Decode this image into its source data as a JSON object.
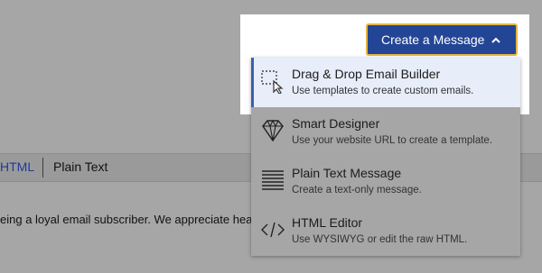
{
  "background": {
    "tabs": {
      "html_label": "HTML",
      "plain_text_label": "Plain Text"
    },
    "body_text": "eing a loyal email subscriber. We appreciate hearing"
  },
  "create_button": {
    "label": "Create a Message",
    "icon": "chevron-up-icon"
  },
  "menu": {
    "items": [
      {
        "title": "Drag & Drop Email Builder",
        "subtitle": "Use templates to create custom emails.",
        "icon": "drag-drop-icon",
        "active": true
      },
      {
        "title": "Smart Designer",
        "subtitle": "Use your website URL to create a template.",
        "icon": "diamond-icon",
        "active": false
      },
      {
        "title": "Plain Text Message",
        "subtitle": "Create a text-only message.",
        "icon": "text-lines-icon",
        "active": false
      },
      {
        "title": "HTML Editor",
        "subtitle": "Use WYSIWYG or edit the raw HTML.",
        "icon": "code-icon",
        "active": false
      }
    ]
  },
  "colors": {
    "overlay": "#a6a6a6",
    "button_bg": "#234596",
    "button_border": "#e7b544",
    "active_item_bg": "#e7edf9",
    "active_item_border": "#3b5fb5",
    "link_blue": "#1f3a99"
  }
}
